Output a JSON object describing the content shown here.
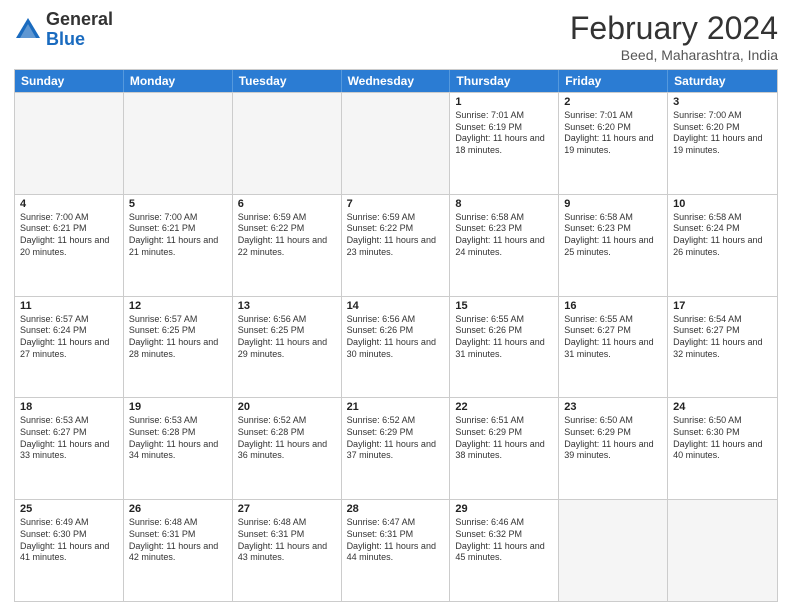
{
  "header": {
    "logo_general": "General",
    "logo_blue": "Blue",
    "month_year": "February 2024",
    "location": "Beed, Maharashtra, India"
  },
  "calendar": {
    "days": [
      "Sunday",
      "Monday",
      "Tuesday",
      "Wednesday",
      "Thursday",
      "Friday",
      "Saturday"
    ],
    "rows": [
      [
        {
          "day": "",
          "empty": true
        },
        {
          "day": "",
          "empty": true
        },
        {
          "day": "",
          "empty": true
        },
        {
          "day": "",
          "empty": true
        },
        {
          "day": "1",
          "sunrise": "7:01 AM",
          "sunset": "6:19 PM",
          "daylight": "11 hours and 18 minutes."
        },
        {
          "day": "2",
          "sunrise": "7:01 AM",
          "sunset": "6:20 PM",
          "daylight": "11 hours and 19 minutes."
        },
        {
          "day": "3",
          "sunrise": "7:00 AM",
          "sunset": "6:20 PM",
          "daylight": "11 hours and 19 minutes."
        }
      ],
      [
        {
          "day": "4",
          "sunrise": "7:00 AM",
          "sunset": "6:21 PM",
          "daylight": "11 hours and 20 minutes."
        },
        {
          "day": "5",
          "sunrise": "7:00 AM",
          "sunset": "6:21 PM",
          "daylight": "11 hours and 21 minutes."
        },
        {
          "day": "6",
          "sunrise": "6:59 AM",
          "sunset": "6:22 PM",
          "daylight": "11 hours and 22 minutes."
        },
        {
          "day": "7",
          "sunrise": "6:59 AM",
          "sunset": "6:22 PM",
          "daylight": "11 hours and 23 minutes."
        },
        {
          "day": "8",
          "sunrise": "6:58 AM",
          "sunset": "6:23 PM",
          "daylight": "11 hours and 24 minutes."
        },
        {
          "day": "9",
          "sunrise": "6:58 AM",
          "sunset": "6:23 PM",
          "daylight": "11 hours and 25 minutes."
        },
        {
          "day": "10",
          "sunrise": "6:58 AM",
          "sunset": "6:24 PM",
          "daylight": "11 hours and 26 minutes."
        }
      ],
      [
        {
          "day": "11",
          "sunrise": "6:57 AM",
          "sunset": "6:24 PM",
          "daylight": "11 hours and 27 minutes."
        },
        {
          "day": "12",
          "sunrise": "6:57 AM",
          "sunset": "6:25 PM",
          "daylight": "11 hours and 28 minutes."
        },
        {
          "day": "13",
          "sunrise": "6:56 AM",
          "sunset": "6:25 PM",
          "daylight": "11 hours and 29 minutes."
        },
        {
          "day": "14",
          "sunrise": "6:56 AM",
          "sunset": "6:26 PM",
          "daylight": "11 hours and 30 minutes."
        },
        {
          "day": "15",
          "sunrise": "6:55 AM",
          "sunset": "6:26 PM",
          "daylight": "11 hours and 31 minutes."
        },
        {
          "day": "16",
          "sunrise": "6:55 AM",
          "sunset": "6:27 PM",
          "daylight": "11 hours and 31 minutes."
        },
        {
          "day": "17",
          "sunrise": "6:54 AM",
          "sunset": "6:27 PM",
          "daylight": "11 hours and 32 minutes."
        }
      ],
      [
        {
          "day": "18",
          "sunrise": "6:53 AM",
          "sunset": "6:27 PM",
          "daylight": "11 hours and 33 minutes."
        },
        {
          "day": "19",
          "sunrise": "6:53 AM",
          "sunset": "6:28 PM",
          "daylight": "11 hours and 34 minutes."
        },
        {
          "day": "20",
          "sunrise": "6:52 AM",
          "sunset": "6:28 PM",
          "daylight": "11 hours and 36 minutes."
        },
        {
          "day": "21",
          "sunrise": "6:52 AM",
          "sunset": "6:29 PM",
          "daylight": "11 hours and 37 minutes."
        },
        {
          "day": "22",
          "sunrise": "6:51 AM",
          "sunset": "6:29 PM",
          "daylight": "11 hours and 38 minutes."
        },
        {
          "day": "23",
          "sunrise": "6:50 AM",
          "sunset": "6:29 PM",
          "daylight": "11 hours and 39 minutes."
        },
        {
          "day": "24",
          "sunrise": "6:50 AM",
          "sunset": "6:30 PM",
          "daylight": "11 hours and 40 minutes."
        }
      ],
      [
        {
          "day": "25",
          "sunrise": "6:49 AM",
          "sunset": "6:30 PM",
          "daylight": "11 hours and 41 minutes."
        },
        {
          "day": "26",
          "sunrise": "6:48 AM",
          "sunset": "6:31 PM",
          "daylight": "11 hours and 42 minutes."
        },
        {
          "day": "27",
          "sunrise": "6:48 AM",
          "sunset": "6:31 PM",
          "daylight": "11 hours and 43 minutes."
        },
        {
          "day": "28",
          "sunrise": "6:47 AM",
          "sunset": "6:31 PM",
          "daylight": "11 hours and 44 minutes."
        },
        {
          "day": "29",
          "sunrise": "6:46 AM",
          "sunset": "6:32 PM",
          "daylight": "11 hours and 45 minutes."
        },
        {
          "day": "",
          "empty": true
        },
        {
          "day": "",
          "empty": true
        }
      ]
    ]
  }
}
